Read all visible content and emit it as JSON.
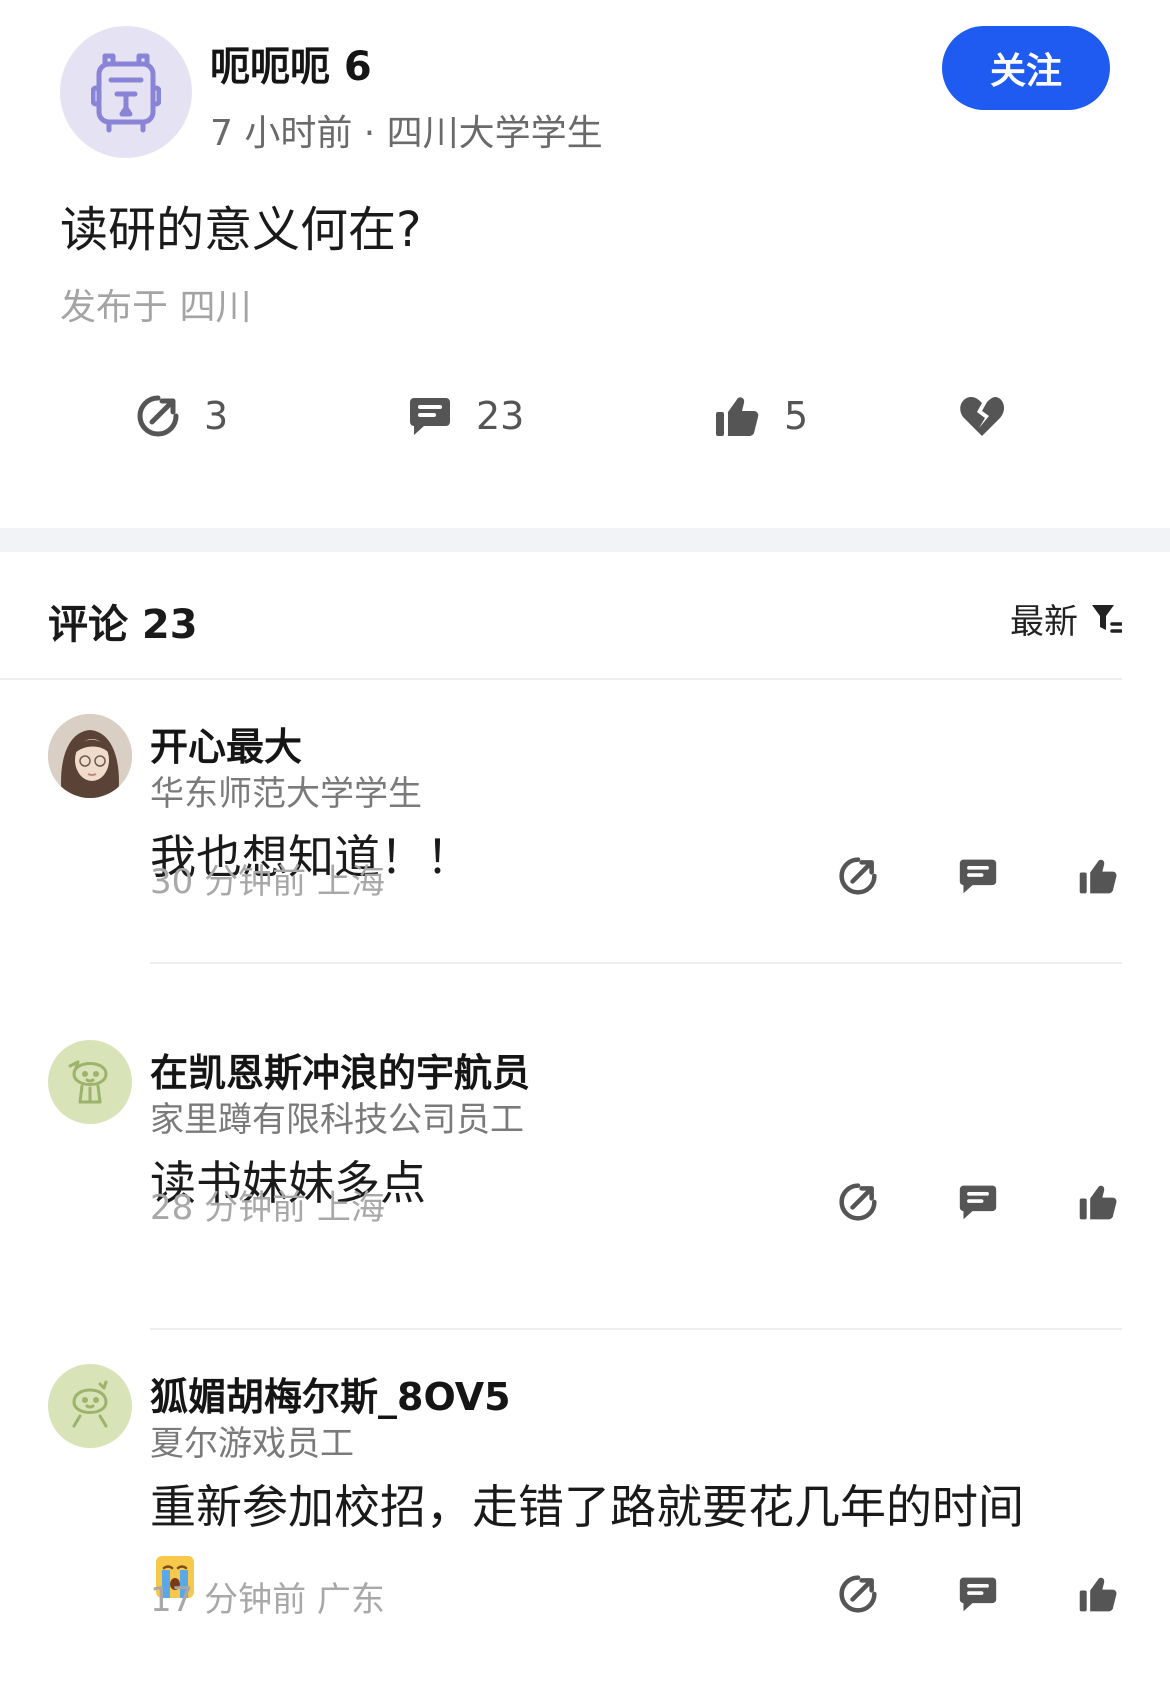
{
  "post": {
    "author": "呃呃呃 6",
    "meta": "7 小时前 · 四川大学学生",
    "follow_label": "关注",
    "title": "读研的意义何在?",
    "location": "发布于 四川",
    "avatar_icon": "backpack-robot-avatar",
    "accent_color": "#1f5bf0"
  },
  "actions": {
    "share_count": "3",
    "comment_count": "23",
    "like_count": "5"
  },
  "comments_header": {
    "title": "评论 23",
    "sort_label": "最新"
  },
  "comments": [
    {
      "name": "开心最大",
      "org": "华东师范大学学生",
      "text": "我也想知道！！",
      "time": "30 分钟前  上海",
      "avatar": "girl-photo-avatar"
    },
    {
      "name": "在凯恩斯冲浪的宇航员",
      "org": "家里蹲有限科技公司员工",
      "text": "读书妹妹多点",
      "time": "28 分钟前  上海",
      "avatar": "green-cartoon-avatar"
    },
    {
      "name": "狐媚胡梅尔斯_8OV5",
      "org": "夏尔游戏员工",
      "text": "重新参加校招，走错了路就要花几年的时间",
      "time": "17 分钟前  广东",
      "avatar": "green-cartoon-avatar"
    }
  ]
}
